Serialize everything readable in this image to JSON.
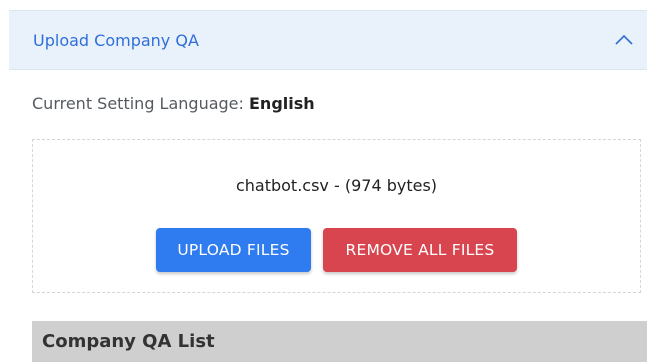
{
  "accordion": {
    "title": "Upload Company QA",
    "toggle_icon": "chevron-up-icon",
    "colors": {
      "header_bg": "#e9f1fb",
      "title": "#2f6fd9"
    }
  },
  "language": {
    "label": "Current Setting Language:",
    "value": "English"
  },
  "dropzone": {
    "file_info": "chatbot.csv - (974 bytes)",
    "upload_label": "UPLOAD FILES",
    "remove_label": "REMOVE ALL FILES",
    "colors": {
      "upload": "#2f7bf0",
      "remove": "#d8454f"
    }
  },
  "list": {
    "title": "Company QA List"
  }
}
